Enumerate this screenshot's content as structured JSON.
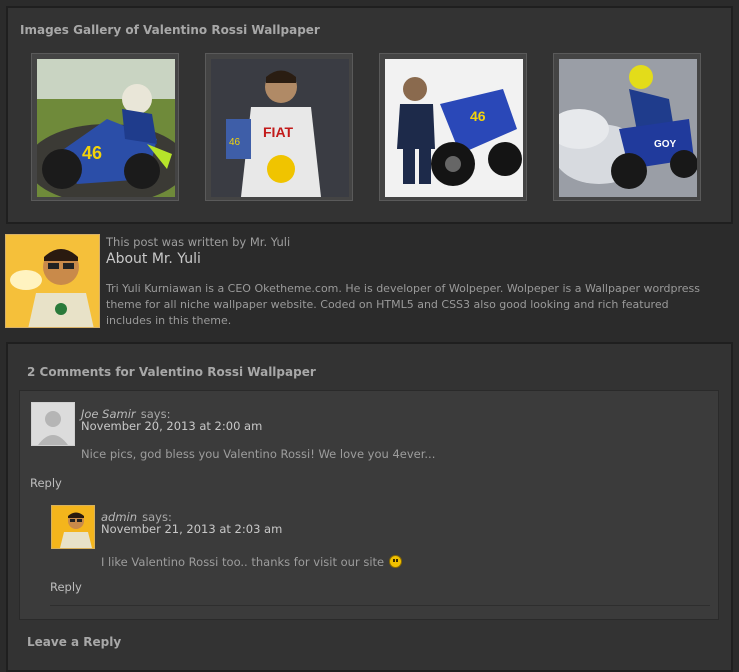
{
  "gallery": {
    "title": "Images Gallery of Valentino Rossi Wallpaper",
    "thumbnails": [
      {
        "alt": "valentino-rossi-racing-46-wallpaper"
      },
      {
        "alt": "valentino-rossi-fiat-suit-wallpaper"
      },
      {
        "alt": "valentino-rossi-with-yamaha-bike-wallpaper"
      },
      {
        "alt": "valentino-rossi-burnout-wallpaper"
      }
    ]
  },
  "author": {
    "written_by": "This post was written by Mr. Yuli",
    "heading": "About Mr. Yuli",
    "bio": "Tri Yuli Kurniawan is a CEO Oketheme.com. He is developer of Wolpeper. Wolpeper is a Wallpaper wordpress theme for all niche wallpaper website. Coded on HTML5 and CSS3 also good looking and rich featured includes in this theme."
  },
  "comments": {
    "title": "2 Comments for Valentino Rossi Wallpaper",
    "items": [
      {
        "name": "Joe Samir",
        "says": "says:",
        "date": "November 20, 2013 at 2:00 am",
        "text": "Nice pics, god bless you Valentino Rossi! We love you 4ever...",
        "reply": "Reply"
      },
      {
        "name": "admin",
        "says": "says:",
        "date": "November 21, 2013 at 2:03 am",
        "text": "I like Valentino Rossi too.. thanks for visit our site",
        "reply": "Reply",
        "icon": "smiley-icon"
      }
    ]
  },
  "leave_reply": "Leave a Reply",
  "colors": {
    "background": "#2b2b2b",
    "panel": "#333333",
    "comment_panel": "#3b3b3b",
    "text": "#9a9a9a"
  }
}
